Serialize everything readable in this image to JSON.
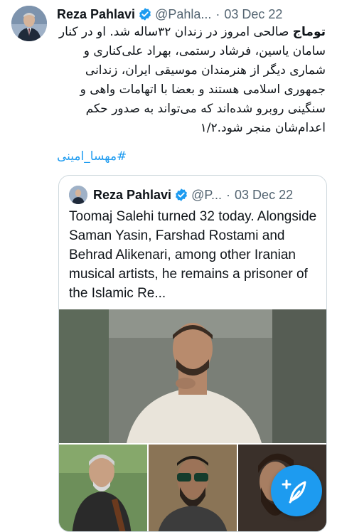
{
  "tweet": {
    "author_name": "Reza Pahlavi",
    "handle": "@Pahla...",
    "separator": "·",
    "date": "03 Dec 22",
    "body_bold": "توماج",
    "body_rest": " صالحی امروز در زندان ۳۲ساله شد. او در کنار سامان یاسین، فرشاد رستمی، بهراد علی‌کناری و شماری دیگر از هنرمندان موسیقی ایران، زندانی جمهوری اسلامی هستند و بعضا با اتهامات واهی و سنگینی روبرو شده‌اند که می‌تواند به صدور حکم اعدام‌شان منجر شود.۱/۲",
    "hashtag": "#مهسا_امینی"
  },
  "quoted_tweet": {
    "author_name": "Reza Pahlavi",
    "handle": "@P...",
    "separator": "·",
    "date": "03 Dec 22",
    "text": "Toomaj Salehi turned 32 today. Alongside Saman Yasin, Farshad Rostami and Behrad Alikenari, among other Iranian musical artists, he remains a prisoner of the Islamic Re..."
  },
  "icons": {
    "verified": "verified-badge-icon",
    "compose": "compose-tweet-icon"
  },
  "colors": {
    "accent": "#1d9bf0",
    "text": "#0f1419",
    "secondary": "#536471",
    "border": "#cfd9de"
  }
}
